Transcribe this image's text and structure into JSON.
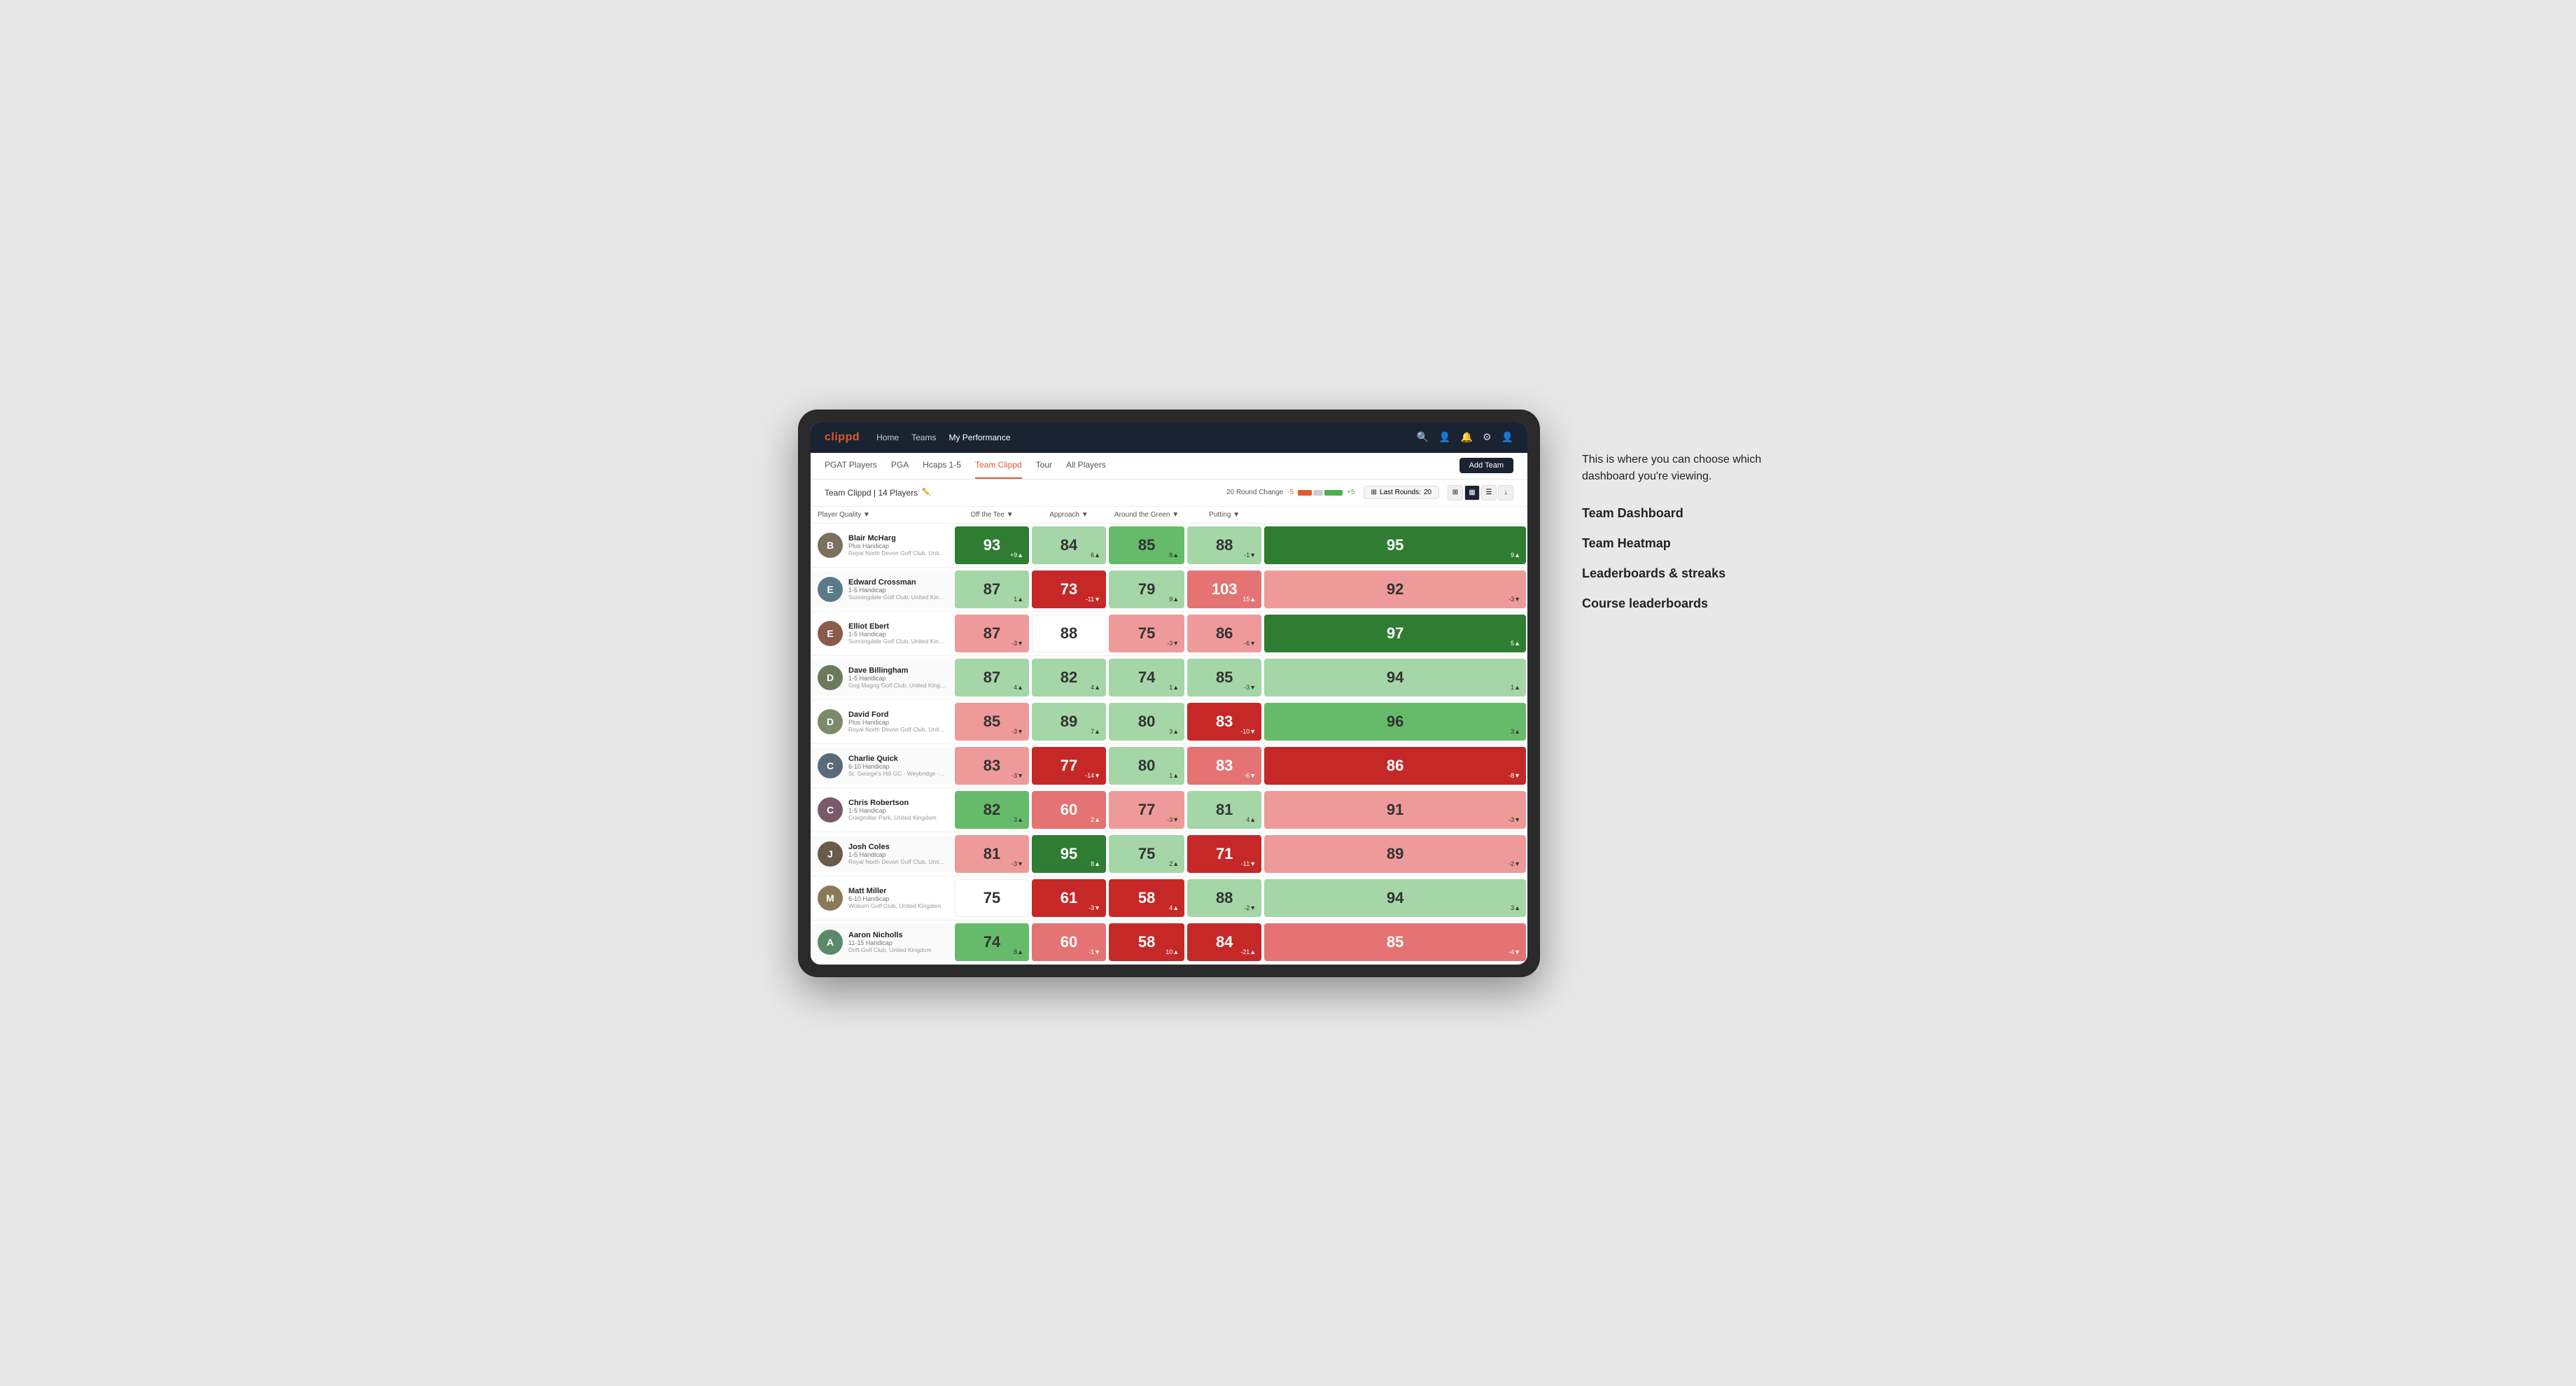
{
  "annotation": {
    "intro": "This is where you can choose which dashboard you're viewing.",
    "options": [
      "Team Dashboard",
      "Team Heatmap",
      "Leaderboards & streaks",
      "Course leaderboards"
    ]
  },
  "navbar": {
    "logo": "clippd",
    "links": [
      "Home",
      "Teams",
      "My Performance"
    ],
    "active_link": "My Performance"
  },
  "subnav": {
    "links": [
      "PGAT Players",
      "PGA",
      "Hcaps 1-5",
      "Team Clippd",
      "Tour",
      "All Players"
    ],
    "active_link": "Team Clippd",
    "add_team_label": "Add Team"
  },
  "team_header": {
    "title": "Team Clippd",
    "count": "14 Players",
    "round_change_label": "20 Round Change",
    "neg_label": "-5",
    "pos_label": "+5",
    "last_rounds_label": "Last Rounds:",
    "last_rounds_value": "20"
  },
  "table": {
    "headers": [
      {
        "label": "Player Quality ▼",
        "type": "sort"
      },
      {
        "label": "Off the Tee ▼",
        "type": "sort"
      },
      {
        "label": "Approach ▼",
        "type": "sort"
      },
      {
        "label": "Around the Green ▼",
        "type": "sort"
      },
      {
        "label": "Putting ▼",
        "type": "sort"
      }
    ],
    "rows": [
      {
        "name": "Blair McHarg",
        "handicap": "Plus Handicap",
        "club": "Royal North Devon Golf Club, United Kingdom",
        "avatar_color": "#7b6f5e",
        "avatar_initial": "B",
        "scores": [
          {
            "value": 93,
            "change": "+9▲",
            "color": "green-dark"
          },
          {
            "value": 84,
            "change": "6▲",
            "color": "green-light"
          },
          {
            "value": 85,
            "change": "8▲",
            "color": "green-mid"
          },
          {
            "value": 88,
            "change": "-1▼",
            "color": "green-light"
          },
          {
            "value": 95,
            "change": "9▲",
            "color": "green-dark"
          }
        ]
      },
      {
        "name": "Edward Crossman",
        "handicap": "1-5 Handicap",
        "club": "Sunningdale Golf Club, United Kingdom",
        "avatar_color": "#5a7a8a",
        "avatar_initial": "E",
        "scores": [
          {
            "value": 87,
            "change": "1▲",
            "color": "green-light"
          },
          {
            "value": 73,
            "change": "-11▼",
            "color": "red-dark"
          },
          {
            "value": 79,
            "change": "9▲",
            "color": "green-light"
          },
          {
            "value": 103,
            "change": "15▲",
            "color": "red-mid"
          },
          {
            "value": 92,
            "change": "-3▼",
            "color": "red-light"
          }
        ]
      },
      {
        "name": "Elliot Ebert",
        "handicap": "1-5 Handicap",
        "club": "Sunningdale Golf Club, United Kingdom",
        "avatar_color": "#8a5a4a",
        "avatar_initial": "E",
        "scores": [
          {
            "value": 87,
            "change": "-3▼",
            "color": "red-light"
          },
          {
            "value": 88,
            "change": "",
            "color": "white"
          },
          {
            "value": 75,
            "change": "-3▼",
            "color": "red-light"
          },
          {
            "value": 86,
            "change": "-6▼",
            "color": "red-light"
          },
          {
            "value": 97,
            "change": "5▲",
            "color": "green-dark"
          }
        ]
      },
      {
        "name": "Dave Billingham",
        "handicap": "1-5 Handicap",
        "club": "Gog Magog Golf Club, United Kingdom",
        "avatar_color": "#6a7a5a",
        "avatar_initial": "D",
        "scores": [
          {
            "value": 87,
            "change": "4▲",
            "color": "green-light"
          },
          {
            "value": 82,
            "change": "4▲",
            "color": "green-light"
          },
          {
            "value": 74,
            "change": "1▲",
            "color": "green-light"
          },
          {
            "value": 85,
            "change": "-3▼",
            "color": "green-light"
          },
          {
            "value": 94,
            "change": "1▲",
            "color": "green-light"
          }
        ]
      },
      {
        "name": "David Ford",
        "handicap": "Plus Handicap",
        "club": "Royal North Devon Golf Club, United Kingdom",
        "avatar_color": "#7a8a6a",
        "avatar_initial": "D",
        "scores": [
          {
            "value": 85,
            "change": "-3▼",
            "color": "red-light"
          },
          {
            "value": 89,
            "change": "7▲",
            "color": "green-light"
          },
          {
            "value": 80,
            "change": "3▲",
            "color": "green-light"
          },
          {
            "value": 83,
            "change": "-10▼",
            "color": "red-dark"
          },
          {
            "value": 96,
            "change": "3▲",
            "color": "green-mid"
          }
        ]
      },
      {
        "name": "Charlie Quick",
        "handicap": "6-10 Handicap",
        "club": "St. George's Hill GC - Weybridge - Surrey, Uni...",
        "avatar_color": "#5a6a7a",
        "avatar_initial": "C",
        "scores": [
          {
            "value": 83,
            "change": "-3▼",
            "color": "red-light"
          },
          {
            "value": 77,
            "change": "-14▼",
            "color": "red-dark"
          },
          {
            "value": 80,
            "change": "1▲",
            "color": "green-light"
          },
          {
            "value": 83,
            "change": "-6▼",
            "color": "red-mid"
          },
          {
            "value": 86,
            "change": "-8▼",
            "color": "red-dark"
          }
        ]
      },
      {
        "name": "Chris Robertson",
        "handicap": "1-5 Handicap",
        "club": "Craigmillar Park, United Kingdom",
        "avatar_color": "#7a5a6a",
        "avatar_initial": "C",
        "scores": [
          {
            "value": 82,
            "change": "3▲",
            "color": "green-mid"
          },
          {
            "value": 60,
            "change": "2▲",
            "color": "red-mid"
          },
          {
            "value": 77,
            "change": "-3▼",
            "color": "red-light"
          },
          {
            "value": 81,
            "change": "4▲",
            "color": "green-light"
          },
          {
            "value": 91,
            "change": "-3▼",
            "color": "red-light"
          }
        ]
      },
      {
        "name": "Josh Coles",
        "handicap": "1-5 Handicap",
        "club": "Royal North Devon Golf Club, United Kingdom",
        "avatar_color": "#6a5a4a",
        "avatar_initial": "J",
        "scores": [
          {
            "value": 81,
            "change": "-3▼",
            "color": "red-light"
          },
          {
            "value": 95,
            "change": "8▲",
            "color": "green-dark"
          },
          {
            "value": 75,
            "change": "2▲",
            "color": "green-light"
          },
          {
            "value": 71,
            "change": "-11▼",
            "color": "red-dark"
          },
          {
            "value": 89,
            "change": "-2▼",
            "color": "red-light"
          }
        ]
      },
      {
        "name": "Matt Miller",
        "handicap": "6-10 Handicap",
        "club": "Woburn Golf Club, United Kingdom",
        "avatar_color": "#8a7a5a",
        "avatar_initial": "M",
        "scores": [
          {
            "value": 75,
            "change": "",
            "color": "white"
          },
          {
            "value": 61,
            "change": "-3▼",
            "color": "red-dark"
          },
          {
            "value": 58,
            "change": "4▲",
            "color": "red-dark"
          },
          {
            "value": 88,
            "change": "-2▼",
            "color": "green-light"
          },
          {
            "value": 94,
            "change": "3▲",
            "color": "green-light"
          }
        ]
      },
      {
        "name": "Aaron Nicholls",
        "handicap": "11-15 Handicap",
        "club": "Drift Golf Club, United Kingdom",
        "avatar_color": "#5a8a6a",
        "avatar_initial": "A",
        "scores": [
          {
            "value": 74,
            "change": "8▲",
            "color": "green-mid"
          },
          {
            "value": 60,
            "change": "-1▼",
            "color": "red-mid"
          },
          {
            "value": 58,
            "change": "10▲",
            "color": "red-dark"
          },
          {
            "value": 84,
            "change": "-21▲",
            "color": "red-dark"
          },
          {
            "value": 85,
            "change": "-4▼",
            "color": "red-mid"
          }
        ]
      }
    ]
  }
}
